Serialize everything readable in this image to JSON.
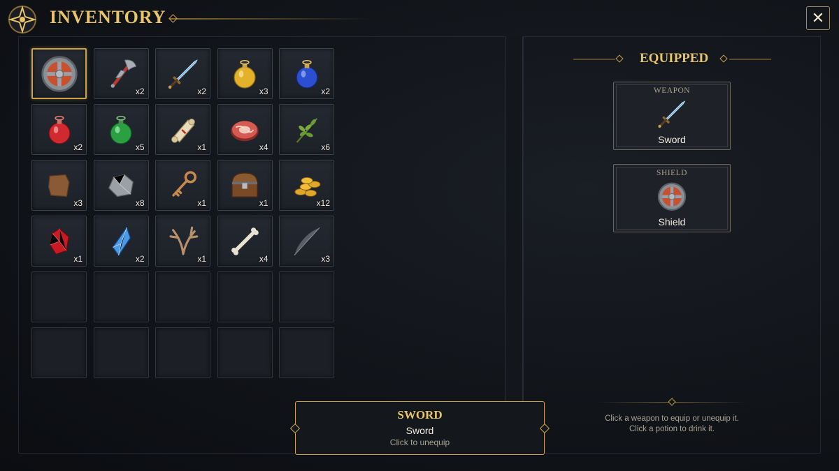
{
  "header": {
    "title": "INVENTORY",
    "close_label": "✕"
  },
  "inventory": {
    "slots": [
      {
        "item": "shield",
        "qty": ""
      },
      {
        "item": "axe",
        "qty": "x2"
      },
      {
        "item": "sword",
        "qty": "x2"
      },
      {
        "item": "yellow-potion",
        "qty": "x3"
      },
      {
        "item": "blue-potion",
        "qty": "x2"
      },
      {
        "item": "red-potion",
        "qty": "x2"
      },
      {
        "item": "green-potion",
        "qty": "x5"
      },
      {
        "item": "scroll",
        "qty": "x1"
      },
      {
        "item": "meat",
        "qty": "x4"
      },
      {
        "item": "herb",
        "qty": "x6"
      },
      {
        "item": "leather",
        "qty": "x3"
      },
      {
        "item": "stone",
        "qty": "x8"
      },
      {
        "item": "key",
        "qty": "x1"
      },
      {
        "item": "chest",
        "qty": "x1"
      },
      {
        "item": "gold-coins",
        "qty": "x12"
      },
      {
        "item": "ruby",
        "qty": "x1"
      },
      {
        "item": "crystal",
        "qty": "x2"
      },
      {
        "item": "antler",
        "qty": "x1"
      },
      {
        "item": "bone",
        "qty": "x4"
      },
      {
        "item": "feather",
        "qty": "x3"
      },
      {
        "item": "",
        "qty": ""
      },
      {
        "item": "",
        "qty": ""
      },
      {
        "item": "",
        "qty": ""
      },
      {
        "item": "",
        "qty": ""
      },
      {
        "item": "",
        "qty": ""
      },
      {
        "item": "",
        "qty": ""
      },
      {
        "item": "",
        "qty": ""
      },
      {
        "item": "",
        "qty": ""
      },
      {
        "item": "",
        "qty": ""
      },
      {
        "item": "",
        "qty": ""
      }
    ]
  },
  "equipped": {
    "title": "EQUIPPED",
    "weapon": {
      "label": "WEAPON",
      "name": "Sword",
      "icon": "sword-icon"
    },
    "shield": {
      "label": "SHIELD",
      "name": "Shield",
      "icon": "shield-icon"
    }
  },
  "tooltip": {
    "title": "SWORD",
    "name": "Sword",
    "hint": "Click to unequip"
  },
  "help": {
    "line1": "Click a weapon to equip or unequip it.",
    "line2": "Click a potion to drink it."
  },
  "colors": {
    "accent": "#e8c46a",
    "border_gold": "#c9a24d",
    "background": "#0f1217"
  }
}
